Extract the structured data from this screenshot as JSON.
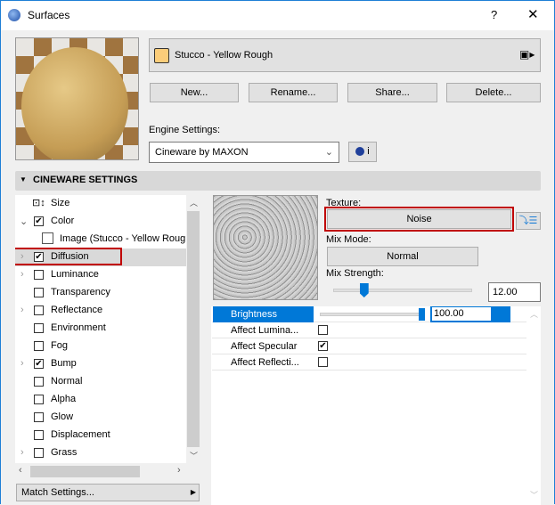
{
  "window": {
    "title": "Surfaces",
    "help": "?",
    "close": "✕"
  },
  "surface": {
    "name": "Stucco - Yellow Rough",
    "swatch_color": "#fbcd7a"
  },
  "buttons": {
    "new": "New...",
    "rename": "Rename...",
    "share": "Share...",
    "delete": "Delete..."
  },
  "engine": {
    "label": "Engine Settings:",
    "value": "Cineware by MAXON",
    "info": "i"
  },
  "section": {
    "title": "CINEWARE SETTINGS"
  },
  "tree": [
    {
      "label": "Size",
      "type": "size"
    },
    {
      "label": "Color",
      "checked": true,
      "expanded": true
    },
    {
      "label": "Image (Stucco - Yellow Roug",
      "type": "image"
    },
    {
      "label": "Diffusion",
      "checked": true,
      "expandable": true,
      "selected": true
    },
    {
      "label": "Luminance",
      "checked": false,
      "expandable": true
    },
    {
      "label": "Transparency",
      "checked": false
    },
    {
      "label": "Reflectance",
      "checked": false,
      "expandable": true
    },
    {
      "label": "Environment",
      "checked": false
    },
    {
      "label": "Fog",
      "checked": false
    },
    {
      "label": "Bump",
      "checked": true,
      "expandable": true
    },
    {
      "label": "Normal",
      "checked": false
    },
    {
      "label": "Alpha",
      "checked": false
    },
    {
      "label": "Glow",
      "checked": false
    },
    {
      "label": "Displacement",
      "checked": false
    },
    {
      "label": "Grass",
      "checked": false,
      "expandable": true
    }
  ],
  "match_settings": "Match Settings...",
  "texture": {
    "label": "Texture:",
    "value": "Noise",
    "mix_mode_label": "Mix Mode:",
    "mix_mode": "Normal",
    "mix_strength_label": "Mix Strength:",
    "mix_strength": "12.00",
    "mix_strength_fraction": 0.12
  },
  "properties": [
    {
      "label": "Brightness",
      "value": "100.00",
      "fraction": 1.0,
      "selected": true
    },
    {
      "label": "Affect Lumina...",
      "checked": false
    },
    {
      "label": "Affect Specular",
      "checked": true
    },
    {
      "label": "Affect Reflecti...",
      "checked": false
    }
  ],
  "colors": {
    "accent": "#0078d7",
    "highlight": "#c00000"
  }
}
